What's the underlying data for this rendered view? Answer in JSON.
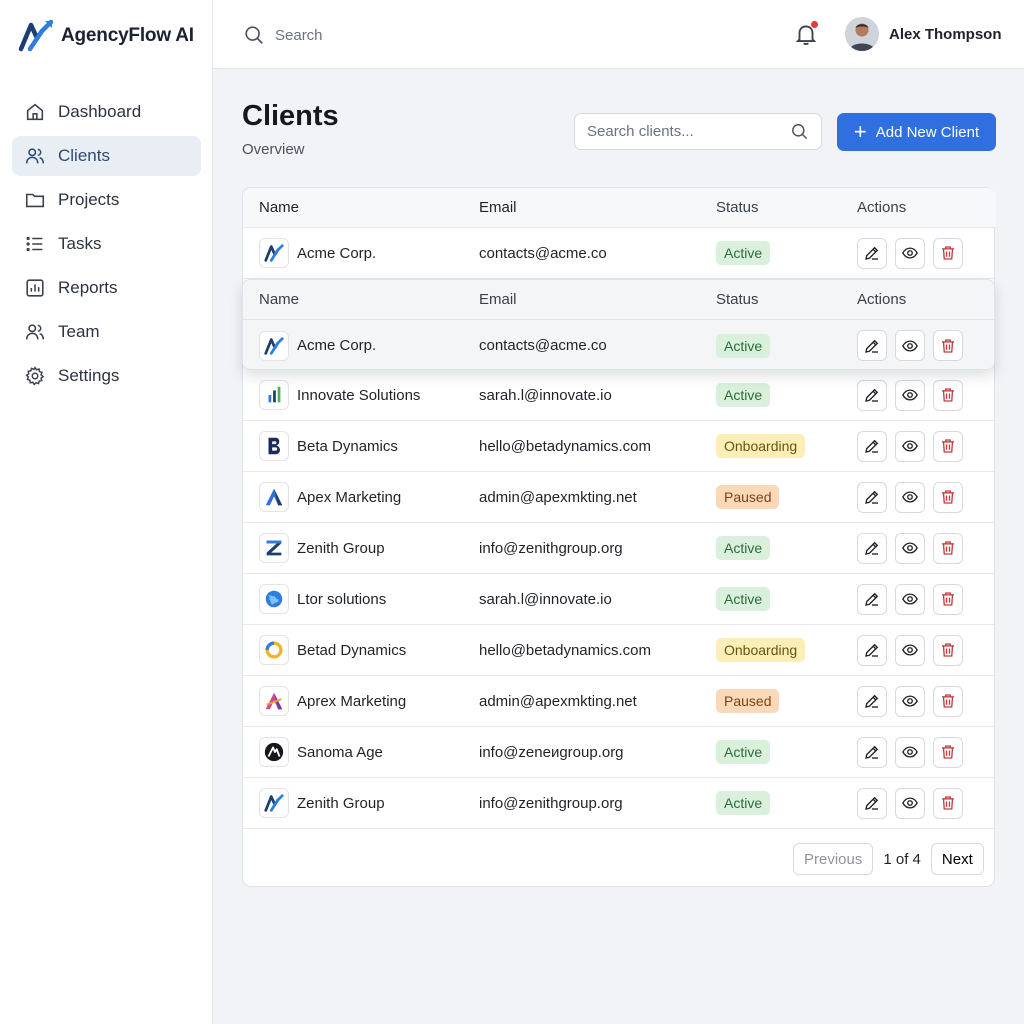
{
  "app": {
    "name": "AgencyFlow AI"
  },
  "sidebar": {
    "items": [
      {
        "label": "Dashboard",
        "icon": "home-icon"
      },
      {
        "label": "Clients",
        "icon": "users-icon",
        "active": true
      },
      {
        "label": "Projects",
        "icon": "folder-icon"
      },
      {
        "label": "Tasks",
        "icon": "list-icon"
      },
      {
        "label": "Reports",
        "icon": "chart-icon"
      },
      {
        "label": "Team",
        "icon": "team-icon"
      },
      {
        "label": "Settings",
        "icon": "gear-icon"
      }
    ]
  },
  "topbar": {
    "search_placeholder": "Search",
    "user_name": "Alex Thompson",
    "notification_dot_color": "#e03a3a"
  },
  "page": {
    "title": "Clients",
    "subtitle": "Overview",
    "search_placeholder": "Search clients...",
    "add_button": "Add New Client"
  },
  "table": {
    "headers": {
      "name": "Name",
      "email": "Email",
      "status": "Status",
      "actions": "Actions"
    },
    "rows": [
      {
        "name": "Acme Corp.",
        "email": "contacts@acme.co",
        "status": "Active",
        "status_type": "active",
        "logo": "acme-logo-icon"
      },
      {
        "name": "Innovate Solutions",
        "email": "sarah.l@innovate.io",
        "status": "Active",
        "status_type": "active",
        "logo": "bars-logo-icon"
      },
      {
        "name": "Beta Dynamics",
        "email": "hello@betadynamics.com",
        "status": "Onboarding",
        "status_type": "onboarding",
        "logo": "b-logo-icon"
      },
      {
        "name": "Apex Marketing",
        "email": "admin@apexmkting.net",
        "status": "Paused",
        "status_type": "paused",
        "logo": "a-logo-icon"
      },
      {
        "name": "Zenith Group",
        "email": "info@zenithgroup.org",
        "status": "Active",
        "status_type": "active",
        "logo": "z-logo-icon"
      },
      {
        "name": "Ltor solutions",
        "email": "sarah.l@innovate.io",
        "status": "Active",
        "status_type": "active",
        "logo": "globe-logo-icon"
      },
      {
        "name": "Betad Dynamics",
        "email": "hello@betadynamics.com",
        "status": "Onboarding",
        "status_type": "onboarding",
        "logo": "ring-logo-icon"
      },
      {
        "name": "Aprex Marketing",
        "email": "admin@apexmkting.net",
        "status": "Paused",
        "status_type": "paused",
        "logo": "aprex-logo-icon"
      },
      {
        "name": "Sanoma Age",
        "email": "info@zeneиgroup.org",
        "status": "Active",
        "status_type": "active",
        "logo": "dark-circle-logo-icon"
      },
      {
        "name": "Zenith Group",
        "email": "info@zenithgroup.org",
        "status": "Active",
        "status_type": "active",
        "logo": "acme-logo-icon"
      }
    ],
    "floating_row": {
      "name": "Acme Corp.",
      "email": "contacts@acme.co",
      "status": "Active"
    }
  },
  "pagination": {
    "previous": "Previous",
    "info": "1 of 4",
    "next": "Next"
  },
  "colors": {
    "primary": "#2f6fdf",
    "active_badge": "#d8f0dc",
    "onboarding_badge": "#fbeeb6",
    "paused_badge": "#fbd8b8",
    "delete": "#c43c3c"
  }
}
